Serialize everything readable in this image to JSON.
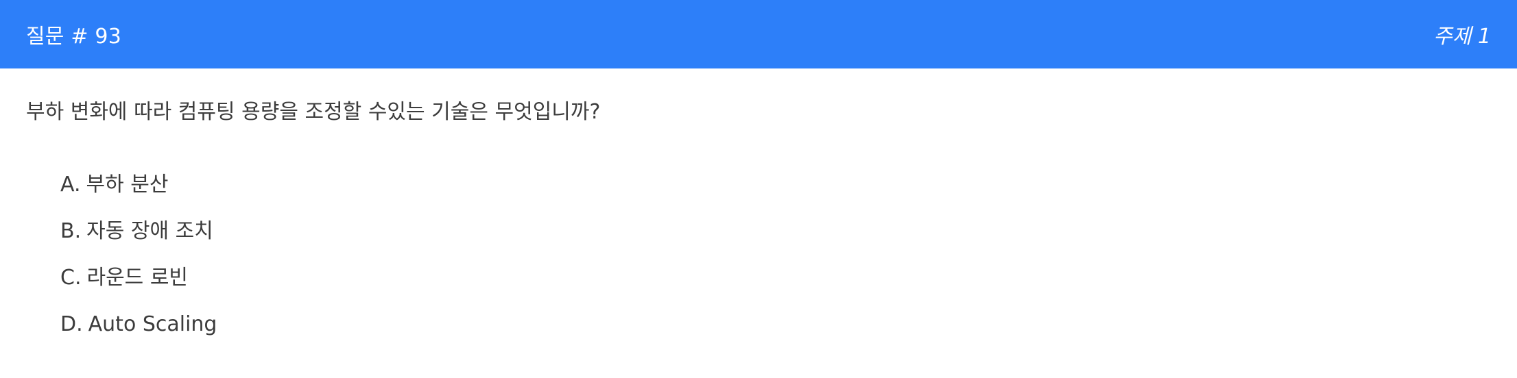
{
  "header": {
    "title": "질문 # 93",
    "topic": "주제 1",
    "background_color": "#2d7ff9"
  },
  "question": {
    "text": "부하 변화에 따라 컴퓨팅 용량을 조정할 수있는 기술은 무엇입니까?"
  },
  "options": [
    {
      "letter": "A.",
      "text": "부하 분산"
    },
    {
      "letter": "B.",
      "text": "자동 장애 조치"
    },
    {
      "letter": "C.",
      "text": "라운드 로빈"
    },
    {
      "letter": "D.",
      "text": "Auto Scaling"
    }
  ]
}
